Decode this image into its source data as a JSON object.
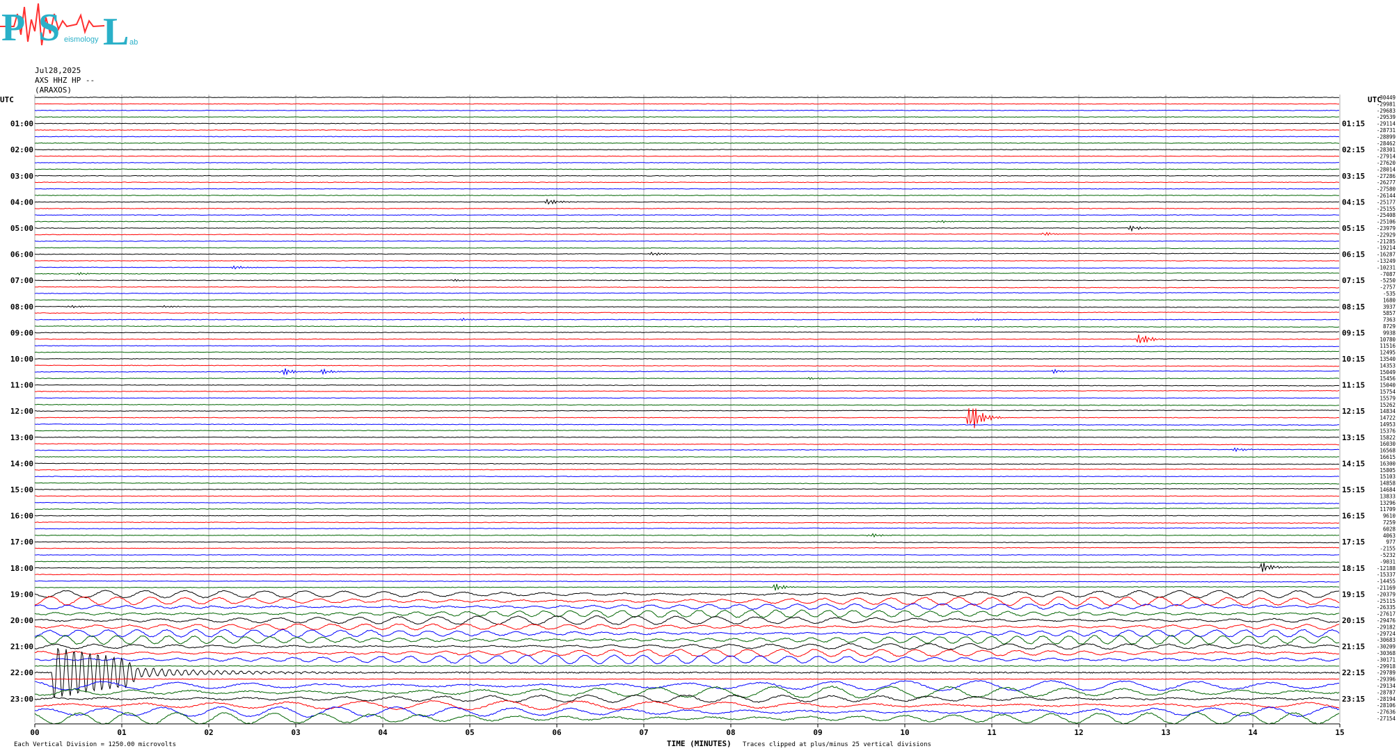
{
  "logo": {
    "letters": [
      "P",
      "S",
      "L"
    ],
    "caption_fragments": [
      "eismology",
      "ab"
    ]
  },
  "header": {
    "date": "Jul28,2025",
    "station": "AXS HHZ HP --",
    "site": "(ARAXOS)"
  },
  "left_label": "UTC",
  "right_label": "UTC",
  "colors": {
    "cycle": [
      "#000000",
      "#ff0000",
      "#0000ff",
      "#006400"
    ],
    "grid": "#888888",
    "logo": "#2ab0c8"
  },
  "chart_data": {
    "type": "line",
    "title": "",
    "xlabel": "TIME (MINUTES)",
    "x_ticks": [
      "00",
      "01",
      "02",
      "03",
      "04",
      "05",
      "06",
      "07",
      "08",
      "09",
      "10",
      "11",
      "12",
      "13",
      "14",
      "15"
    ],
    "xlim": [
      0,
      15
    ],
    "hour_labels_left": [
      "01:00",
      "02:00",
      "03:00",
      "04:00",
      "05:00",
      "06:00",
      "07:00",
      "08:00",
      "09:00",
      "10:00",
      "11:00",
      "12:00",
      "13:00",
      "14:00",
      "15:00",
      "16:00",
      "17:00",
      "18:00",
      "19:00",
      "20:00",
      "21:00",
      "22:00",
      "23:00"
    ],
    "hour_labels_right": [
      "01:15",
      "02:15",
      "03:15",
      "04:15",
      "05:15",
      "06:15",
      "07:15",
      "08:15",
      "09:15",
      "10:15",
      "11:15",
      "12:15",
      "13:15",
      "14:15",
      "15:15",
      "16:15",
      "17:15",
      "18:15",
      "19:15",
      "20:15",
      "21:15",
      "22:15",
      "23:15"
    ],
    "trace_means": [
      "-30449",
      "-29981",
      "-29683",
      "-29539",
      "-29114",
      "-28731",
      "-28899",
      "-28462",
      "-28301",
      "-27914",
      "-27620",
      "-28014",
      "-27286",
      "-26277",
      "-27580",
      "-26144",
      "-25177",
      "-25155",
      "-25408",
      "-25106",
      "-23979",
      "-22929",
      "-21285",
      "-19214",
      "-16287",
      "-13249",
      "-10231",
      "-7087",
      "-5250",
      "-2757",
      "-535",
      "1680",
      "3937",
      "5857",
      "7363",
      "8729",
      "9938",
      "10780",
      "11516",
      "12495",
      "13540",
      "14353",
      "15049",
      "15456",
      "15040",
      "15754",
      "15579",
      "15262",
      "14834",
      "14722",
      "14953",
      "15376",
      "15822",
      "16030",
      "16568",
      "16615",
      "16300",
      "15805",
      "15103",
      "14858",
      "14684",
      "13833",
      "13296",
      "11709",
      "9610",
      "7259",
      "6028",
      "4063",
      "977",
      "-2155",
      "-5232",
      "-9031",
      "-12188",
      "-15337",
      "-14455",
      "-21169",
      "-20379",
      "-25115",
      "-26335",
      "-27617",
      "-29476",
      "-29182",
      "-29724",
      "-30683",
      "-30209",
      "-30368",
      "-30171",
      "-29918",
      "-29789",
      "-29396",
      "-29134",
      "-28787",
      "-28194",
      "-28106",
      "-27636",
      "-27154"
    ],
    "footer_left": "Each Vertical Division = 1250.00 microvolts",
    "footer_right": "Traces clipped at plus/minus 25 vertical divisions",
    "events": [
      {
        "trace": 16,
        "minute": 5.9,
        "amp": 5
      },
      {
        "trace": 19,
        "minute": 10.4,
        "amp": 2
      },
      {
        "trace": 20,
        "minute": 12.6,
        "amp": 4
      },
      {
        "trace": 21,
        "minute": 11.6,
        "amp": 3
      },
      {
        "trace": 24,
        "minute": 7.1,
        "amp": 3
      },
      {
        "trace": 26,
        "minute": 2.3,
        "amp": 3
      },
      {
        "trace": 27,
        "minute": 0.5,
        "amp": 2
      },
      {
        "trace": 28,
        "minute": 4.8,
        "amp": 2
      },
      {
        "trace": 32,
        "minute": 0.4,
        "amp": 2
      },
      {
        "trace": 32,
        "minute": 1.5,
        "amp": 2
      },
      {
        "trace": 34,
        "minute": 10.8,
        "amp": 2
      },
      {
        "trace": 34,
        "minute": 4.9,
        "amp": 2
      },
      {
        "trace": 37,
        "minute": 12.7,
        "amp": 9
      },
      {
        "trace": 42,
        "minute": 2.85,
        "amp": 6
      },
      {
        "trace": 42,
        "minute": 3.3,
        "amp": 4
      },
      {
        "trace": 42,
        "minute": 11.7,
        "amp": 3
      },
      {
        "trace": 43,
        "minute": 8.9,
        "amp": 2
      },
      {
        "trace": 49,
        "minute": 10.75,
        "amp": 25
      },
      {
        "trace": 54,
        "minute": 13.8,
        "amp": 3
      },
      {
        "trace": 67,
        "minute": 9.6,
        "amp": 3
      },
      {
        "trace": 72,
        "minute": 14.1,
        "amp": 8
      },
      {
        "trace": 75,
        "minute": 8.5,
        "amp": 6
      }
    ]
  }
}
